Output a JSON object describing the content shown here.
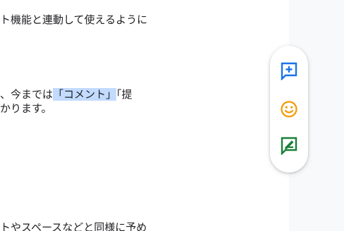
{
  "document": {
    "line1": "ト機能と連動して使えるように",
    "line2_before": "、今までは",
    "line2_highlight": "「コメント」",
    "line2_after": "「提",
    "line3": "かります。",
    "line4": "トやスペースなどと同様に予め"
  },
  "side_actions": [
    {
      "icon": "add-comment-icon",
      "color": "#1a73e8"
    },
    {
      "icon": "emoji-reaction-icon",
      "color": "#f29900"
    },
    {
      "icon": "suggest-edit-icon",
      "color": "#188038"
    }
  ],
  "colors": {
    "selection_highlight": "#c2dbff",
    "canvas_gray": "#f8f9fa"
  }
}
